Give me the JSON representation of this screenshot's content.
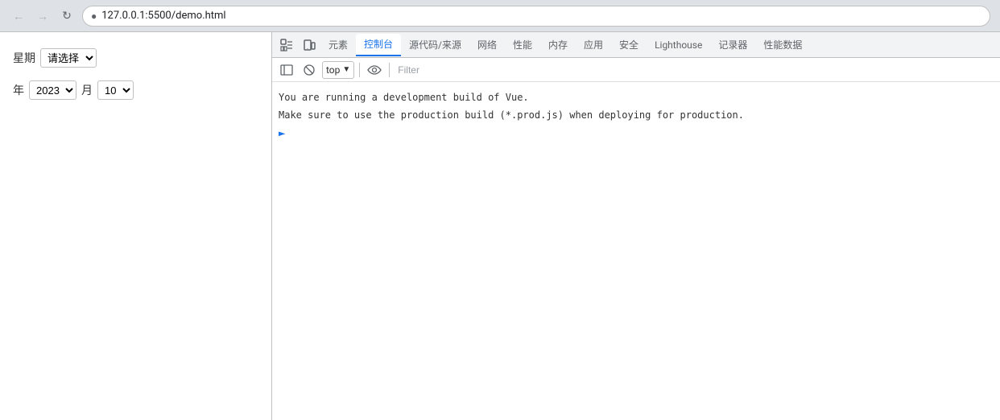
{
  "browser": {
    "url": "127.0.0.1:5500/demo.html",
    "back_disabled": true,
    "forward_disabled": true
  },
  "webpage": {
    "label_weekday": "星期",
    "placeholder_weekday": "请选择",
    "label_year": "年",
    "year_options": [
      "2023"
    ],
    "year_selected": "2023",
    "label_month": "月",
    "month_options": [
      "10"
    ],
    "month_selected": "10"
  },
  "devtools": {
    "tabs": [
      {
        "label": "元素",
        "active": false
      },
      {
        "label": "控制台",
        "active": true
      },
      {
        "label": "源代码/来源",
        "active": false
      },
      {
        "label": "网络",
        "active": false
      },
      {
        "label": "性能",
        "active": false
      },
      {
        "label": "内存",
        "active": false
      },
      {
        "label": "应用",
        "active": false
      },
      {
        "label": "安全",
        "active": false
      },
      {
        "label": "Lighthouse",
        "active": false
      },
      {
        "label": "记录器",
        "active": false
      },
      {
        "label": "性能数据",
        "active": false
      }
    ],
    "toolbar": {
      "context_selector": "top",
      "filter_placeholder": "Filter"
    },
    "console": {
      "lines": [
        "You are running a development build of Vue.",
        "Make sure to use the production build (*.prod.js) when deploying for production."
      ]
    }
  }
}
